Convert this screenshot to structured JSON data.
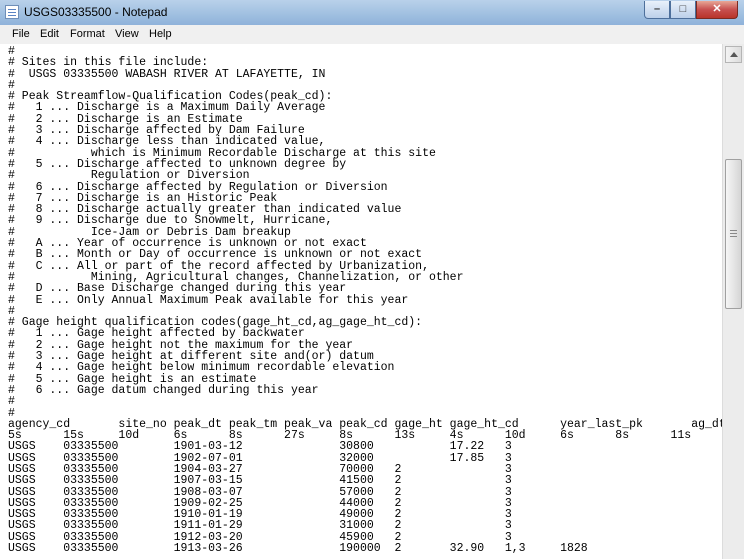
{
  "window": {
    "title": "USGS03335500 - Notepad"
  },
  "menu": {
    "items": [
      "File",
      "Edit",
      "Format",
      "View",
      "Help"
    ]
  },
  "buttons": {
    "minimize": "–",
    "maximize": "□",
    "close": "✕"
  },
  "editor": {
    "lines": [
      "#",
      "# Sites in this file include:",
      "#  USGS 03335500 WABASH RIVER AT LAFAYETTE, IN",
      "#",
      "# Peak Streamflow-Qualification Codes(peak_cd):",
      "#   1 ... Discharge is a Maximum Daily Average",
      "#   2 ... Discharge is an Estimate",
      "#   3 ... Discharge affected by Dam Failure",
      "#   4 ... Discharge less than indicated value,",
      "#           which is Minimum Recordable Discharge at this site",
      "#   5 ... Discharge affected to unknown degree by",
      "#           Regulation or Diversion",
      "#   6 ... Discharge affected by Regulation or Diversion",
      "#   7 ... Discharge is an Historic Peak",
      "#   8 ... Discharge actually greater than indicated value",
      "#   9 ... Discharge due to Snowmelt, Hurricane,",
      "#           Ice-Jam or Debris Dam breakup",
      "#   A ... Year of occurrence is unknown or not exact",
      "#   B ... Month or Day of occurrence is unknown or not exact",
      "#   C ... All or part of the record affected by Urbanization,",
      "#           Mining, Agricultural changes, Channelization, or other",
      "#   D ... Base Discharge changed during this year",
      "#   E ... Only Annual Maximum Peak available for this year",
      "#",
      "# Gage height qualification codes(gage_ht_cd,ag_gage_ht_cd):",
      "#   1 ... Gage height affected by backwater",
      "#   2 ... Gage height not the maximum for the year",
      "#   3 ... Gage height at different site and(or) datum",
      "#   4 ... Gage height below minimum recordable elevation",
      "#   5 ... Gage height is an estimate",
      "#   6 ... Gage datum changed during this year",
      "#",
      "#",
      "agency_cd       site_no peak_dt peak_tm peak_va peak_cd gage_ht gage_ht_cd      year_last_pk       ag_dt",
      "5s      15s     10d     6s      8s      27s     8s      13s     4s      10d     6s      8s      11s",
      "USGS    03335500        1901-03-12              30800           17.22   3",
      "USGS    03335500        1902-07-01              32000           17.85   3",
      "USGS    03335500        1904-03-27              70000   2               3",
      "USGS    03335500        1907-03-15              41500   2               3",
      "USGS    03335500        1908-03-07              57000   2               3",
      "USGS    03335500        1909-02-25              44000   2               3",
      "USGS    03335500        1910-01-19              49000   2               3",
      "USGS    03335500        1911-01-29              31000   2               3",
      "USGS    03335500        1912-03-20              45900   2               3",
      "USGS    03335500        1913-03-26              190000  2       32.90   1,3     1828"
    ]
  }
}
